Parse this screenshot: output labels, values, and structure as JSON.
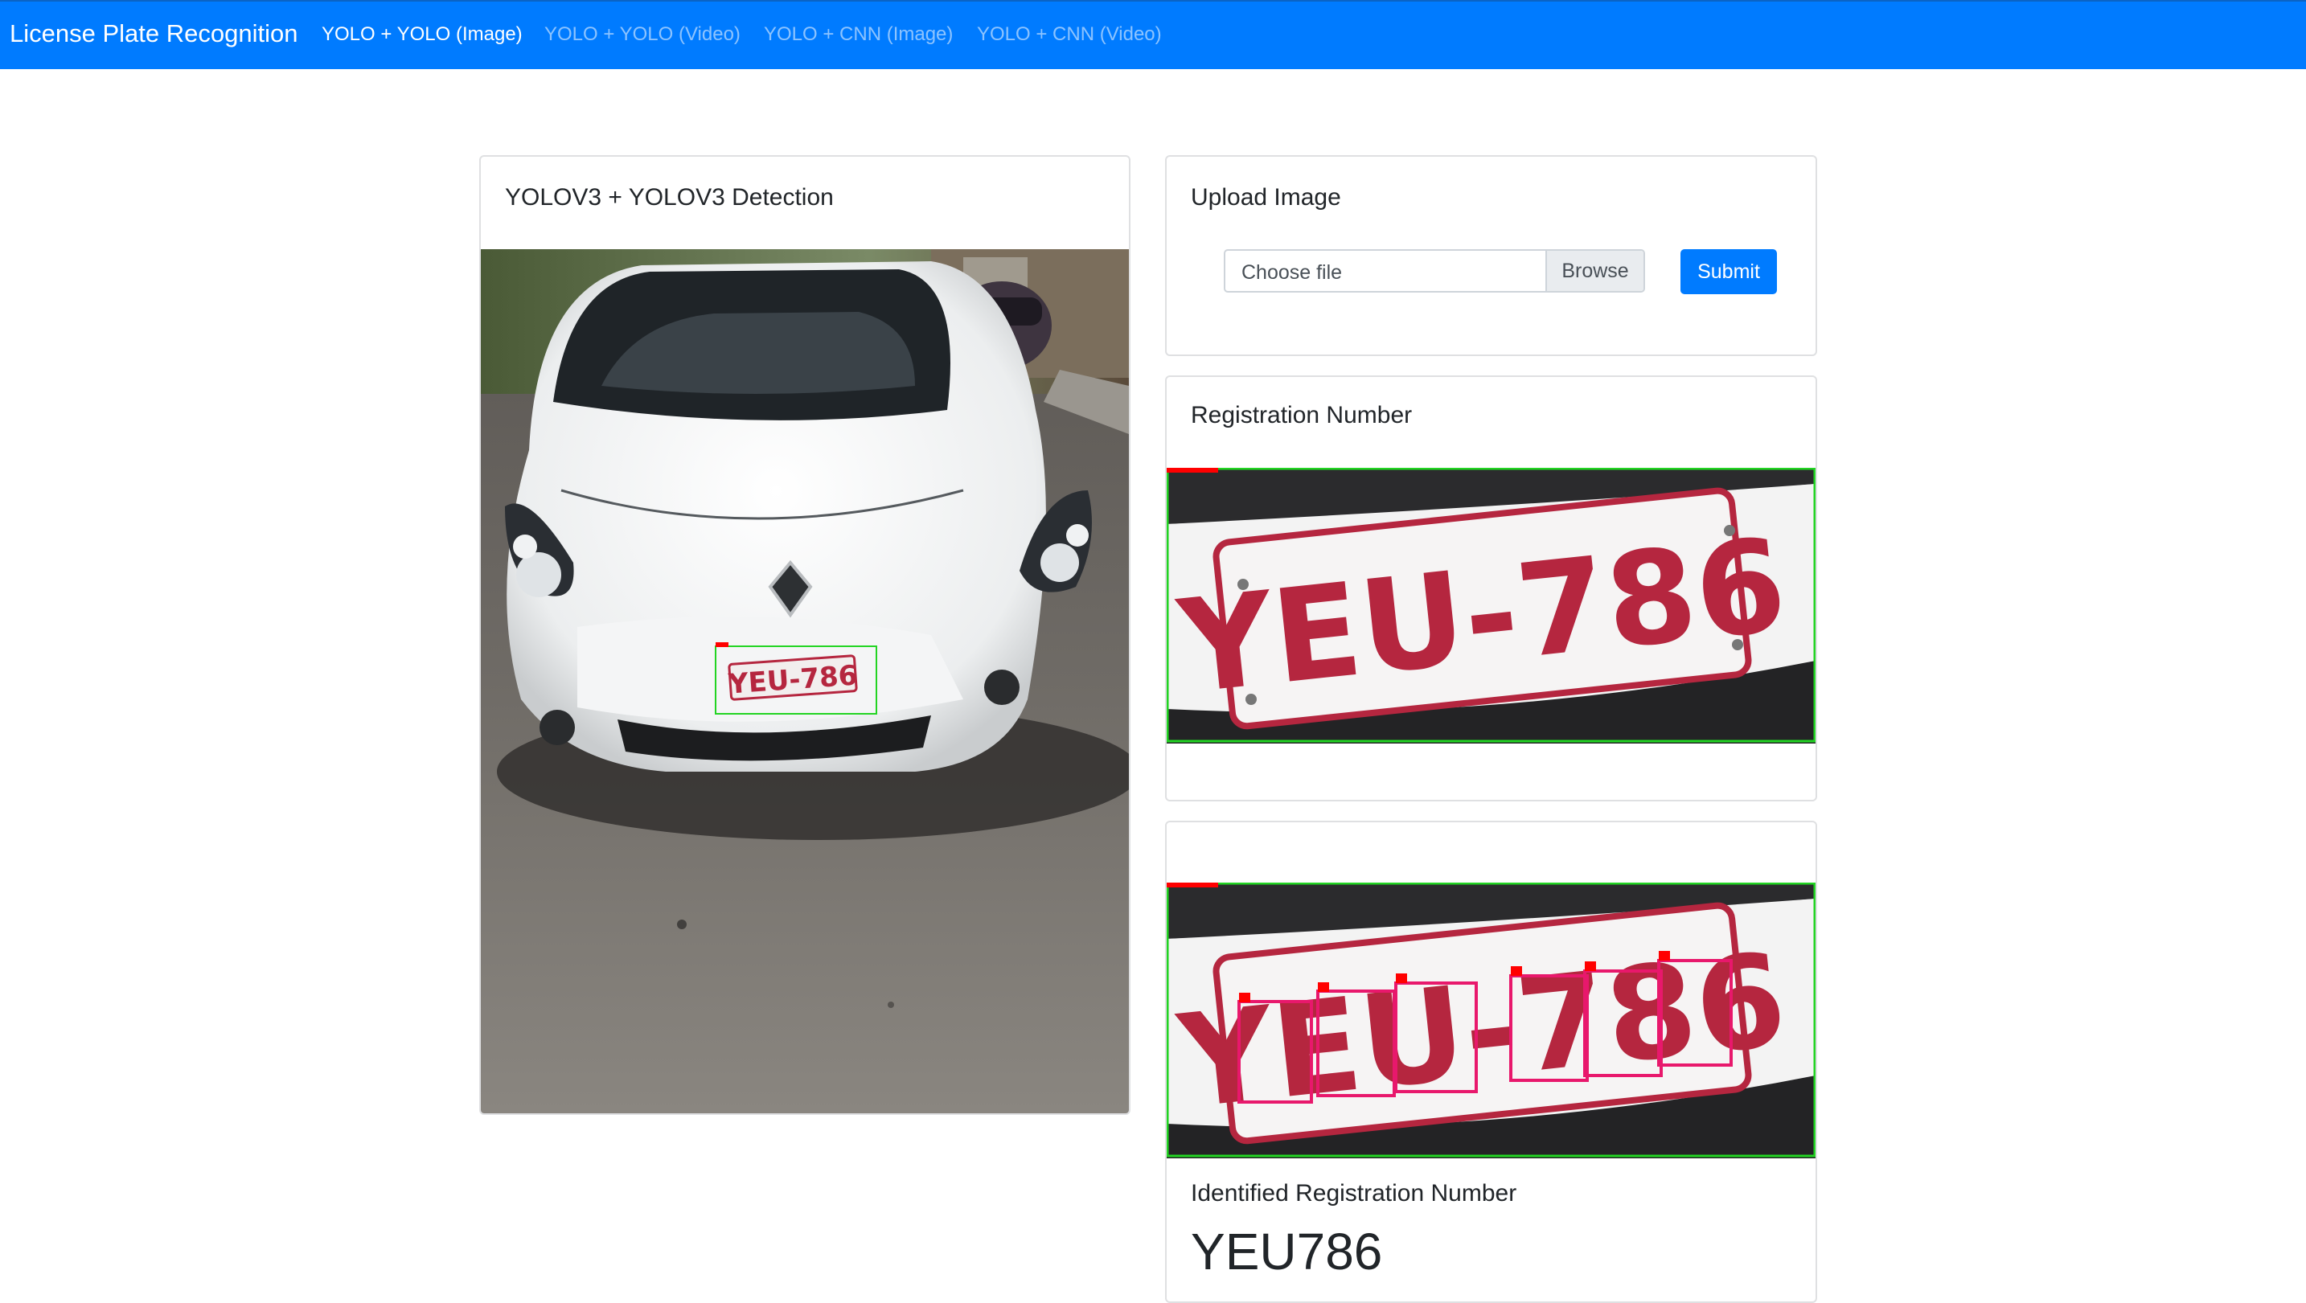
{
  "navbar": {
    "brand": "License Plate Recognition",
    "links": [
      {
        "label": "YOLO + YOLO (Image)",
        "active": true
      },
      {
        "label": "YOLO + YOLO (Video)",
        "active": false
      },
      {
        "label": "YOLO + CNN (Image)",
        "active": false
      },
      {
        "label": "YOLO + CNN (Video)",
        "active": false
      }
    ]
  },
  "detection_card": {
    "title": "YOLOV3 + YOLOV3 Detection",
    "plate_text": "YEU-786"
  },
  "upload_card": {
    "title": "Upload Image",
    "file_label": "Choose file",
    "browse_label": "Browse",
    "submit_label": "Submit"
  },
  "registration_card": {
    "title": "Registration Number",
    "plate_text": "YEU-786"
  },
  "segmentation_card": {
    "plate_text": "YEU-786",
    "identified_label": "Identified Registration Number",
    "identified_value": "YEU786"
  },
  "colors": {
    "primary": "#007bff",
    "box_green": "#22d422",
    "box_red": "#ff0000",
    "char_box": "#e8186c",
    "plate_red": "#b5263f"
  }
}
